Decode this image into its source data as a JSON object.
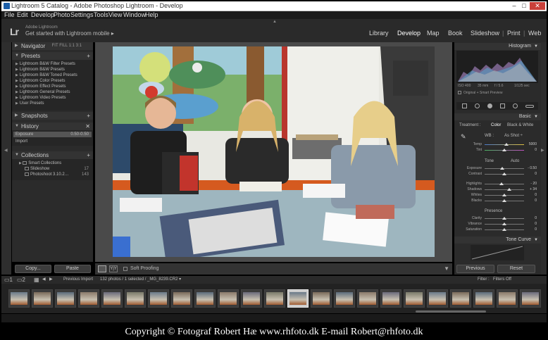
{
  "window": {
    "title": "Lightroom 5 Catalog - Adobe Photoshop Lightroom - Develop",
    "controls": {
      "minimize": "–",
      "maximize": "□",
      "close": "✕"
    }
  },
  "menubar": [
    "File",
    "Edit",
    "Develop",
    "Photo",
    "Settings",
    "Tools",
    "View",
    "Window",
    "Help"
  ],
  "identity": {
    "logo": "Lr",
    "line1": "Adobe Lightroom",
    "line2": "Get started with Lightroom mobile ▸"
  },
  "modules": [
    "Library",
    "Develop",
    "Map",
    "Book",
    "Slideshow",
    "Print",
    "Web"
  ],
  "left": {
    "navigator": {
      "label": "Navigator",
      "options": "FIT  FILL  1:1  3:1"
    },
    "presets": {
      "label": "Presets",
      "items": [
        "Lightroom B&W Filter Presets",
        "Lightroom B&W Presets",
        "Lightroom B&W Toned Presets",
        "Lightroom Color Presets",
        "Lightroom Effect Presets",
        "Lightroom General Presets",
        "Lightroom Video Presets",
        "User Presets"
      ]
    },
    "snapshots": {
      "label": "Snapshots"
    },
    "history": {
      "label": "History",
      "rows": [
        {
          "name": "Exposure",
          "a": "0.50",
          "b": "-0.50"
        },
        {
          "name": "Import",
          "a": "",
          "b": ""
        }
      ]
    },
    "collections": {
      "label": "Collections",
      "rows": [
        {
          "name": "Smart Collections",
          "count": ""
        },
        {
          "name": "Slideshow",
          "count": "17"
        },
        {
          "name": "Photoshoot 3.10.2…",
          "count": "143"
        }
      ]
    },
    "buttons": {
      "copy": "Copy...",
      "paste": "Paste"
    }
  },
  "toolbar": {
    "soft_proofing": "Soft Proofing"
  },
  "right": {
    "histogram": {
      "label": "Histogram",
      "meta": [
        "ISO 400",
        "35 mm",
        "f / 5.6",
        "1/125 sec"
      ],
      "original_preview": "Original + Smart Preview"
    },
    "basic": {
      "label": "Basic",
      "treatment_label": "Treatment :",
      "treatment_color": "Color",
      "treatment_bw": "Black & White",
      "wb_label": "WB :",
      "wb_value": "As Shot ÷",
      "tone_label": "Tone",
      "tone_auto": "Auto",
      "presence_label": "Presence",
      "sliders": [
        {
          "name": "Temp",
          "value": "5000",
          "pos": 0.55
        },
        {
          "name": "Tint",
          "value": "0",
          "pos": 0.5
        },
        {
          "name": "Exposure",
          "value": "- 0.50",
          "pos": 0.45
        },
        {
          "name": "Contrast",
          "value": "0",
          "pos": 0.5
        },
        {
          "name": "Highlights",
          "value": "- 20",
          "pos": 0.42
        },
        {
          "name": "Shadows",
          "value": "+ 34",
          "pos": 0.62
        },
        {
          "name": "Whites",
          "value": "0",
          "pos": 0.5
        },
        {
          "name": "Blacks",
          "value": "0",
          "pos": 0.5
        },
        {
          "name": "Clarity",
          "value": "0",
          "pos": 0.5
        },
        {
          "name": "Vibrance",
          "value": "0",
          "pos": 0.5
        },
        {
          "name": "Saturation",
          "value": "0",
          "pos": 0.5
        }
      ]
    },
    "tone_curve": {
      "label": "Tone Curve"
    },
    "buttons": {
      "previous": "Previous",
      "reset": "Reset"
    }
  },
  "filmbar": {
    "import_label": "Previous Import",
    "status": "132 photos / 1 selected / _MG_8239.CR2 ▾",
    "filter_label": "Filter :",
    "filter_value": "Filters Off"
  },
  "filmstrip": {
    "count": 23,
    "active_index": 12
  },
  "copyright": "Copyright © Fotograf Robert Hæ www.rhfoto.dk E-mail Robert@rhfoto.dk",
  "colors": {
    "panel": "#2b2b2b",
    "accent_red": "#c9403a"
  }
}
